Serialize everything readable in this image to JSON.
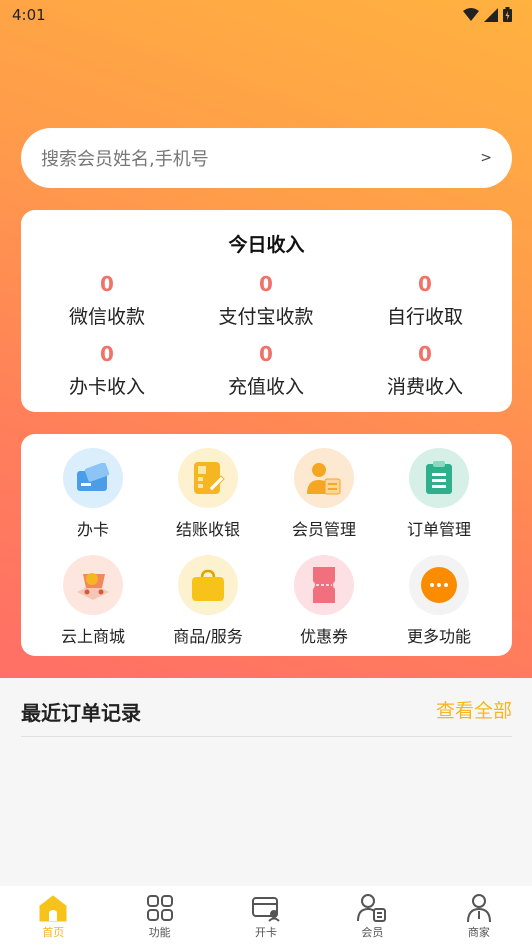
{
  "status_bar": {
    "time": "4:01"
  },
  "search": {
    "placeholder": "搜索会员姓名,手机号",
    "arrow": ">"
  },
  "income": {
    "title": "今日收入",
    "items": [
      {
        "value": "0",
        "label": "微信收款"
      },
      {
        "value": "0",
        "label": "支付宝收款"
      },
      {
        "value": "0",
        "label": "自行收取"
      },
      {
        "value": "0",
        "label": "办卡收入"
      },
      {
        "value": "0",
        "label": "充值收入"
      },
      {
        "value": "0",
        "label": "消费收入"
      }
    ]
  },
  "features": {
    "items": [
      {
        "label": "办卡",
        "icon": "card-icon",
        "bg": "#dbeefc"
      },
      {
        "label": "结账收银",
        "icon": "calculator-icon",
        "bg": "#fdf1cf"
      },
      {
        "label": "会员管理",
        "icon": "member-icon",
        "bg": "#fde9d2"
      },
      {
        "label": "订单管理",
        "icon": "clipboard-icon",
        "bg": "#d6efe7"
      },
      {
        "label": "云上商城",
        "icon": "cart-icon",
        "bg": "#fde6de"
      },
      {
        "label": "商品/服务",
        "icon": "bag-icon",
        "bg": "#fdf2cf"
      },
      {
        "label": "优惠券",
        "icon": "ticket-icon",
        "bg": "#fde0e3"
      },
      {
        "label": "更多功能",
        "icon": "more-icon",
        "bg": "#f3f3f3"
      }
    ]
  },
  "recent_orders": {
    "title": "最近订单记录",
    "view_all": "查看全部"
  },
  "tabbar": {
    "items": [
      {
        "label": "首页",
        "icon": "home-icon",
        "active": true
      },
      {
        "label": "功能",
        "icon": "grid-icon",
        "active": false
      },
      {
        "label": "开卡",
        "icon": "open-card-icon",
        "active": false
      },
      {
        "label": "会员",
        "icon": "member-tab-icon",
        "active": false
      },
      {
        "label": "商家",
        "icon": "merchant-icon",
        "active": false
      }
    ]
  },
  "colors": {
    "accent": "#f5b622",
    "number_red": "#f0736a"
  }
}
